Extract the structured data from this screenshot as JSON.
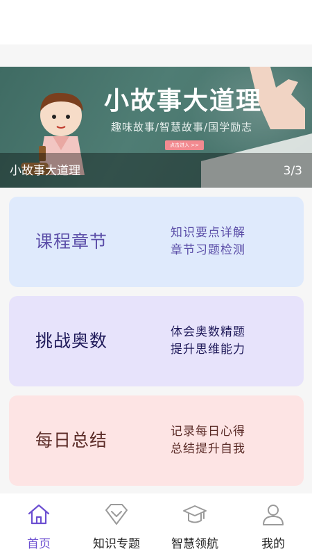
{
  "banner": {
    "title": "小故事大道理",
    "subtitle": "趣味故事/智慧故事/国学励志",
    "enter_button": "点击进入 >>",
    "caption": "小故事大道理",
    "counter": "3/3"
  },
  "cards": [
    {
      "name": "课程章节",
      "desc_line1": "知识要点详解",
      "desc_line2": "章节习题检测"
    },
    {
      "name": "挑战奥数",
      "desc_line1": "体会奥数精题",
      "desc_line2": "提升思维能力"
    },
    {
      "name": "每日总结",
      "desc_line1": "记录每日心得",
      "desc_line2": "总结提升自我"
    }
  ],
  "tabs": [
    {
      "label": "首页",
      "icon": "home-icon",
      "active": true
    },
    {
      "label": "知识专题",
      "icon": "diamond-icon",
      "active": false
    },
    {
      "label": "智慧领航",
      "icon": "graduation-cap-icon",
      "active": false
    },
    {
      "label": "我的",
      "icon": "user-icon",
      "active": false
    }
  ],
  "colors": {
    "accent": "#6c4fd1",
    "card1_bg": "#dfeafc",
    "card2_bg": "#e7e3fb",
    "card3_bg": "#fde4e4"
  }
}
